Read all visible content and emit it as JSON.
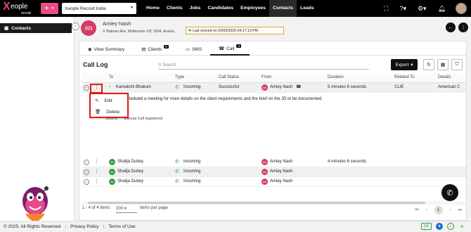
{
  "brand": {
    "logo_x": "X",
    "logo_main": "eople",
    "logo_sub": "recruit"
  },
  "topbar": {
    "tenant": "Xeople Recruit India",
    "nav": [
      "Home",
      "Clients",
      "Jobs",
      "Candidates",
      "Employees",
      "Contacts",
      "Leads"
    ],
    "active_nav": "Contacts"
  },
  "sidebar": {
    "item_label": "Contacts"
  },
  "contact": {
    "initials": "AN",
    "name": "Amiey Nash",
    "address": "Batman Ave, Melbourne VIC 3004, Austra...",
    "sync_text": "Last synced on 20/03/2025 04:17:13 PM"
  },
  "tabs": [
    {
      "label": "View Summary",
      "icon": "eye-icon",
      "badge": ""
    },
    {
      "label": "Clients",
      "icon": "briefcase-icon",
      "badge": "0"
    },
    {
      "label": "SMS",
      "icon": "message-icon",
      "badge": ""
    },
    {
      "label": "Call",
      "icon": "phone-icon",
      "badge": "4"
    }
  ],
  "call_log": {
    "title": "Call Log",
    "search_placeholder": "Search",
    "export_label": "Export",
    "columns": [
      "To",
      "Type",
      "Call Status",
      "From",
      "Duration",
      "Related To",
      "Details"
    ],
    "rows": [
      {
        "to": "Kamakshi Bhakuni",
        "to_initials": "",
        "type": "Incoming",
        "status": "Successful",
        "from": "Amiey Nash",
        "from_initials": "AN",
        "duration": "5 minutes 6 seconds",
        "related": "CLIE",
        "details": "American C"
      },
      {
        "to": "Shailja Dubey",
        "to_initials": "SD",
        "type": "Incoming",
        "status": "",
        "from": "Amiey Nash",
        "from_initials": "AN",
        "duration": "4 minutes 6 seconds",
        "related": "",
        "details": ""
      },
      {
        "to": "Shailja Dubey",
        "to_initials": "SD",
        "type": "Incoming",
        "status": "",
        "from": "Amiey Nash",
        "from_initials": "AN",
        "duration": "",
        "related": "",
        "details": ""
      },
      {
        "to": "Shailja Dubey",
        "to_initials": "SD",
        "type": "Incoming",
        "status": "",
        "from": "Amiey Nash",
        "from_initials": "AN",
        "duration": "",
        "related": "",
        "details": ""
      }
    ],
    "detail_text": "scheduled a meeting for more details on the client requirements and the brief on the JD to be documented.",
    "detail_source": "Source",
    "detail_manual": "Manual Call registered",
    "context_menu": {
      "edit": "Edit",
      "delete": "Delete"
    },
    "footer": {
      "range": "1 - 4 of 4 items",
      "page_size": "200",
      "per_page": "items per page",
      "current_page": "1"
    }
  },
  "bottombar": {
    "copyright": "© 2025. All Rights Reserved",
    "privacy": "Privacy Policy",
    "terms": "Terms of Use",
    "qa": "QA"
  },
  "colors": {
    "accent_pink": "#e84f8a",
    "avatar_red": "#d63b63",
    "green": "#2e9b3c",
    "highlight_red": "#e01c1c"
  }
}
